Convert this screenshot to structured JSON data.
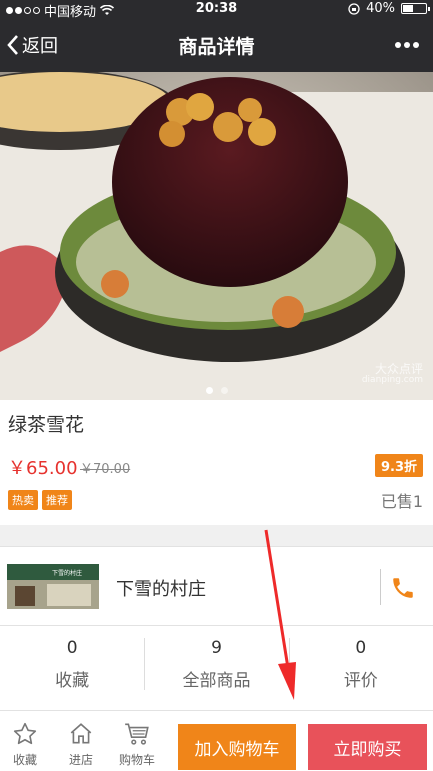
{
  "status_bar": {
    "carrier": "中国移动",
    "time": "20:38",
    "battery": "40%"
  },
  "nav": {
    "back_label": "返回",
    "title": "商品详情"
  },
  "hero": {
    "watermark": "大众点评",
    "watermark_sub": "dianping.com",
    "slides": 2,
    "active_slide": 1
  },
  "product": {
    "name": "绿茶雪花",
    "price": "￥65.00",
    "original_price": "￥70.00",
    "discount": "9.3折",
    "tags": [
      "热卖",
      "推荐"
    ],
    "sold": "已售1"
  },
  "shop": {
    "name": "下雪的村庄",
    "sign_text": "下雪的村庄"
  },
  "stats": [
    {
      "value": "0",
      "label": "收藏"
    },
    {
      "value": "9",
      "label": "全部商品"
    },
    {
      "value": "0",
      "label": "评价"
    }
  ],
  "bottom_bar": {
    "favorite": "收藏",
    "store": "进店",
    "cart": "购物车",
    "add_to_cart": "加入购物车",
    "buy_now": "立即购买"
  },
  "colors": {
    "accent_orange": "#f08519",
    "price_red": "#e6322e",
    "buy_red": "#e8525a",
    "header_dark": "#2b2b2e"
  }
}
